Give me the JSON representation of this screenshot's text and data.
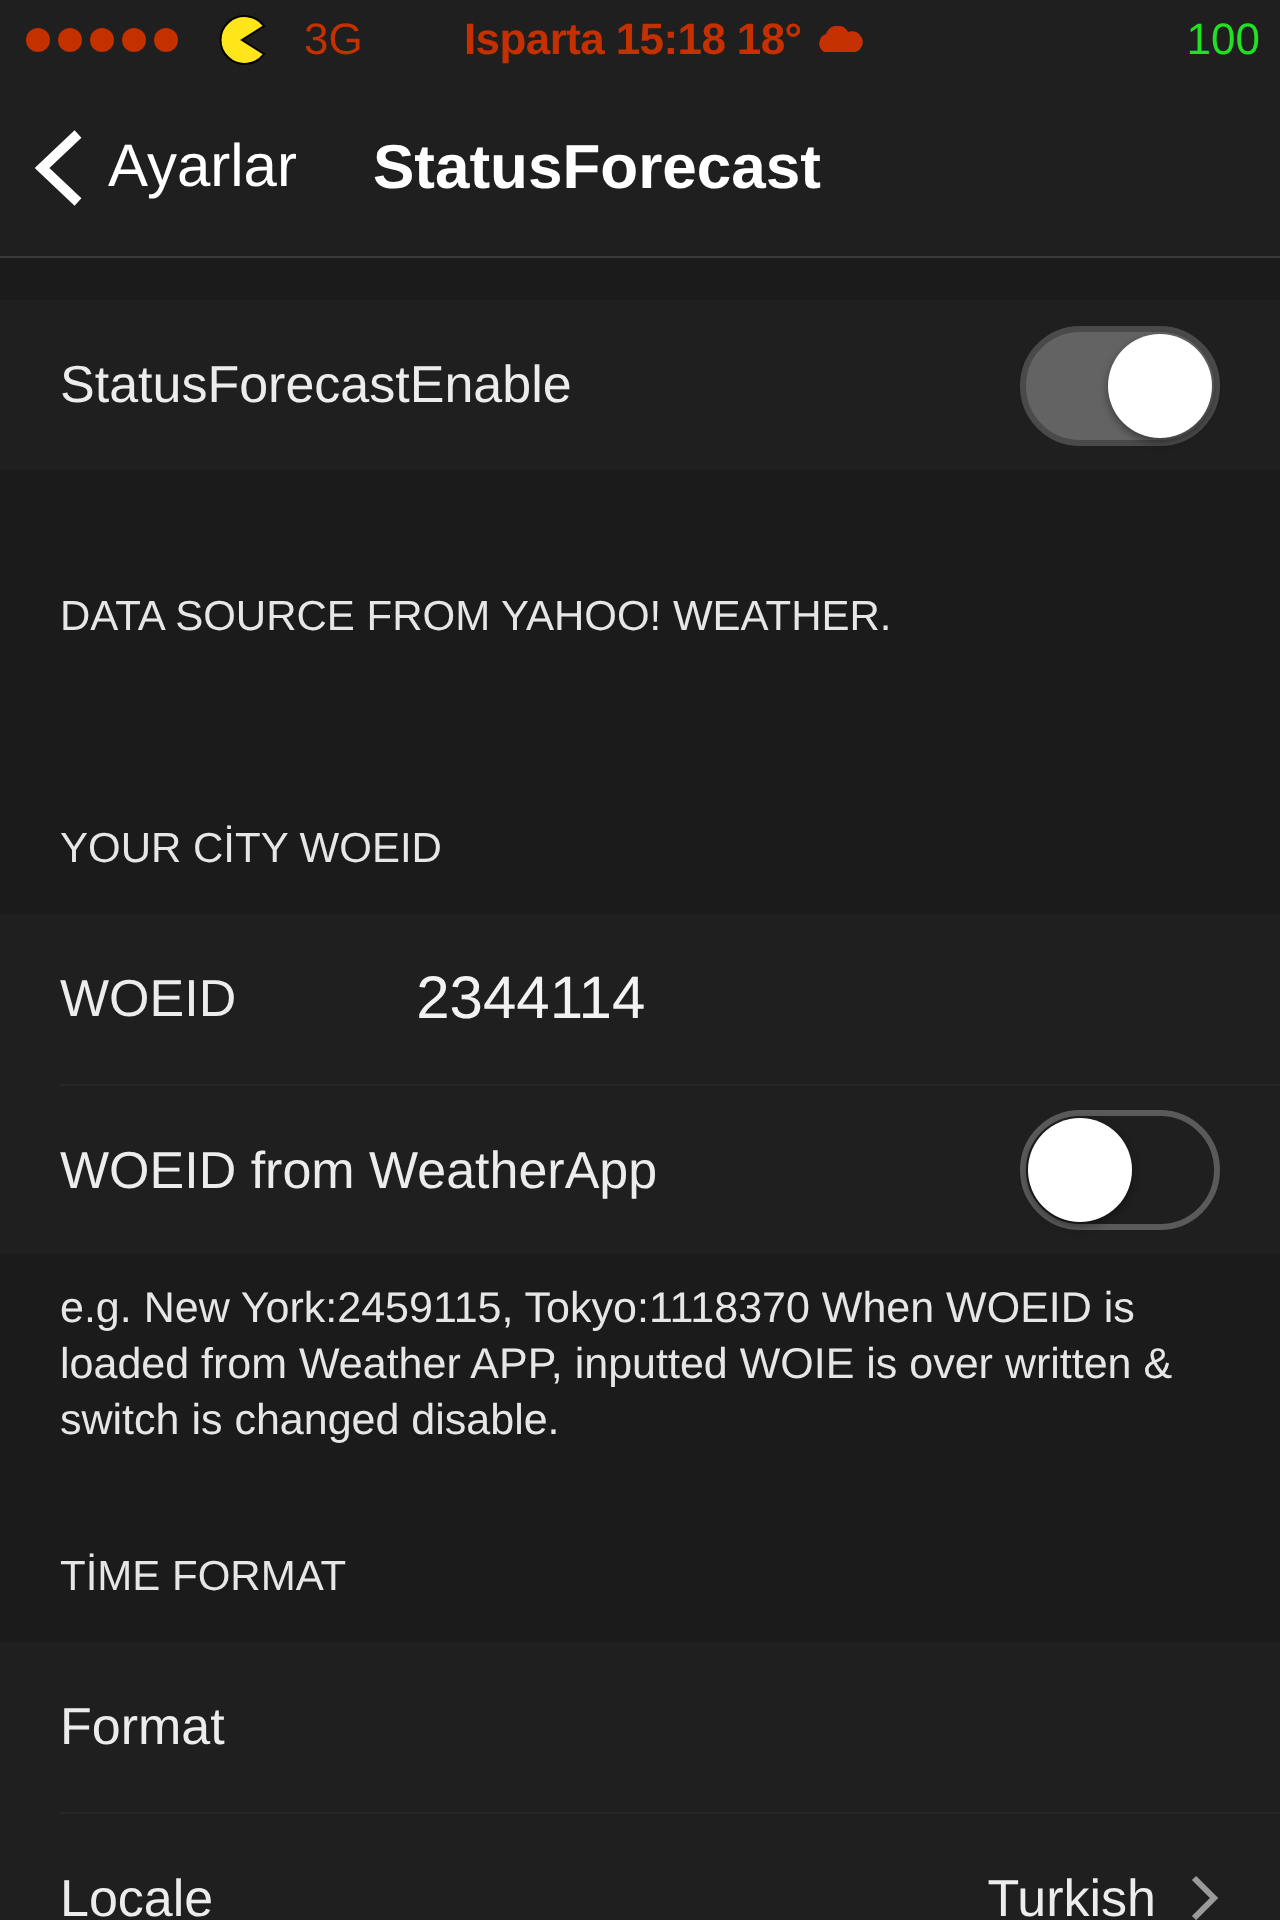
{
  "status_bar": {
    "carrier": "3G",
    "center": "Isparta 15:18 18°",
    "battery": "100"
  },
  "nav": {
    "back": "Ayarlar",
    "title": "StatusForecast"
  },
  "blocks": [
    {
      "kind": "group",
      "rows": [
        {
          "kind": "toggle",
          "label": "StatusForecastEnable",
          "on": true
        }
      ]
    },
    {
      "kind": "header",
      "text": "DATA SOURCE FROM YAHOO! WEATHER."
    },
    {
      "kind": "header",
      "text": "YOUR CİTY WOEID"
    },
    {
      "kind": "group",
      "rows": [
        {
          "kind": "field",
          "label": "WOEID",
          "value": "2344114"
        },
        {
          "kind": "toggle",
          "label": "WOEID from WeatherApp",
          "on": false
        }
      ]
    },
    {
      "kind": "footer",
      "text": "e.g. New York:2459115, Tokyo:1118370  When WOEID is loaded from Weather APP, inputted WOIE is over written & switch is changed disable."
    },
    {
      "kind": "header",
      "text": "TİME FORMAT"
    },
    {
      "kind": "group",
      "rows": [
        {
          "kind": "plain",
          "label": "Format"
        },
        {
          "kind": "detail",
          "label": "Locale",
          "value": "Turkish"
        }
      ]
    }
  ]
}
